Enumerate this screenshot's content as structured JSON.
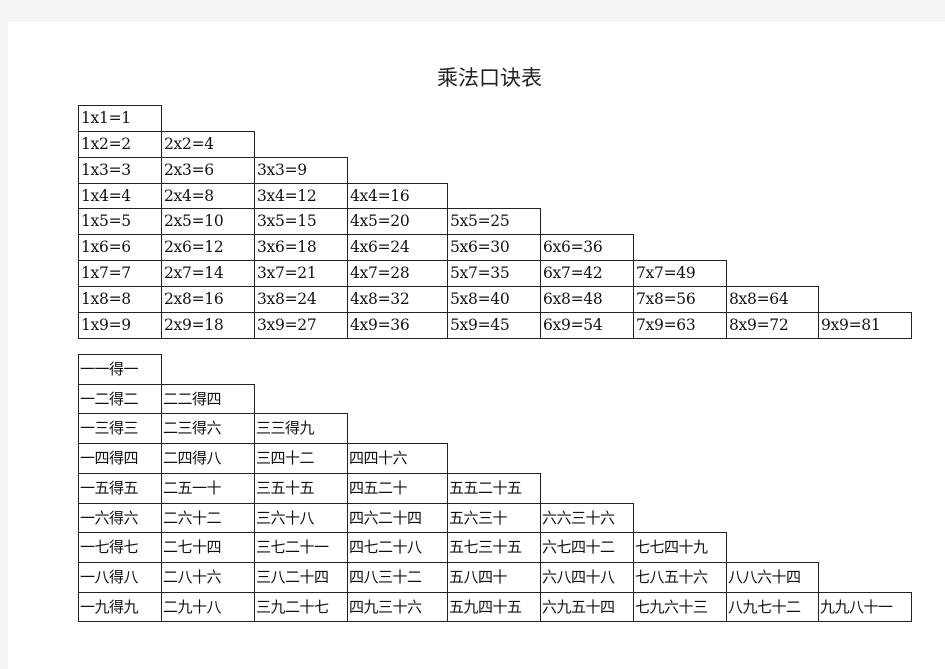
{
  "title": "乘法口诀表",
  "numeric_table": {
    "rows": [
      [
        "1x1=1"
      ],
      [
        "1x2=2",
        "2x2=4"
      ],
      [
        "1x3=3",
        "2x3=6",
        "3x3=9"
      ],
      [
        "1x4=4",
        "2x4=8",
        "3x4=12",
        "4x4=16"
      ],
      [
        "1x5=5",
        "2x5=10",
        "3x5=15",
        "4x5=20",
        "5x5=25"
      ],
      [
        "1x6=6",
        "2x6=12",
        "3x6=18",
        "4x6=24",
        "5x6=30",
        "6x6=36"
      ],
      [
        "1x7=7",
        "2x7=14",
        "3x7=21",
        "4x7=28",
        "5x7=35",
        "6x7=42",
        "7x7=49"
      ],
      [
        "1x8=8",
        "2x8=16",
        "3x8=24",
        "4x8=32",
        "5x8=40",
        "6x8=48",
        "7x8=56",
        "8x8=64"
      ],
      [
        "1x9=9",
        "2x9=18",
        "3x9=27",
        "4x9=36",
        "5x9=45",
        "6x9=54",
        "7x9=63",
        "8x9=72",
        "9x9=81"
      ]
    ]
  },
  "chinese_table": {
    "rows": [
      [
        "一一得一"
      ],
      [
        "一二得二",
        "二二得四"
      ],
      [
        "一三得三",
        "二三得六",
        "三三得九"
      ],
      [
        "一四得四",
        "二四得八",
        "三四十二",
        "四四十六"
      ],
      [
        "一五得五",
        "二五一十",
        "三五十五",
        "四五二十",
        "五五二十五"
      ],
      [
        "一六得六",
        "二六十二",
        "三六十八",
        "四六二十四",
        "五六三十",
        "六六三十六"
      ],
      [
        "一七得七",
        "二七十四",
        "三七二十一",
        "四七二十八",
        "五七三十五",
        "六七四十二",
        "七七四十九"
      ],
      [
        "一八得八",
        "二八十六",
        "三八二十四",
        "四八三十二",
        "五八四十",
        "六八四十八",
        "七八五十六",
        "八八六十四"
      ],
      [
        "一九得九",
        "二九十八",
        "三九二十七",
        "四九三十六",
        "五九四十五",
        "六九五十四",
        "七九六十三",
        "八九七十二",
        "九九八十一"
      ]
    ]
  }
}
